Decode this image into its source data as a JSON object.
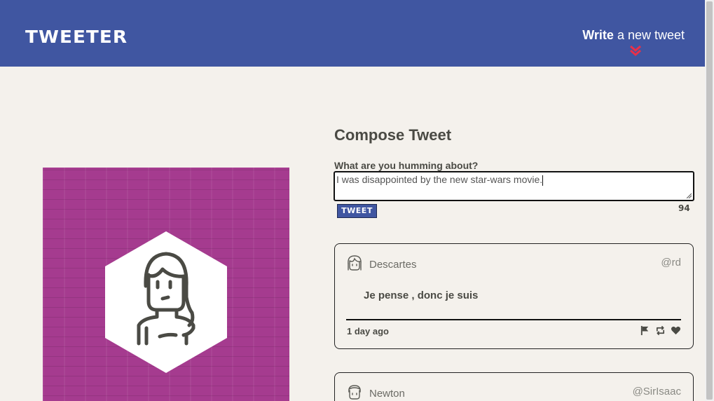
{
  "nav": {
    "brand": "TWEETER",
    "write_bold": "Write",
    "write_rest": " a new tweet",
    "brand_color": "#4056a1",
    "arrow_color": "#e8304a"
  },
  "profile": {
    "background_color": "#a53b8f"
  },
  "compose": {
    "title": "Compose Tweet",
    "label": "What are you humming about?",
    "value": "I was disappointed by the new star-wars movie.",
    "button_label": "TWEET",
    "counter": "94"
  },
  "tweets": [
    {
      "name": "Descartes",
      "handle": "@rd",
      "body": "Je pense , donc je suis",
      "date": "1 day ago",
      "actions": [
        "flag-icon",
        "retweet-icon",
        "heart-icon"
      ]
    },
    {
      "name": "Newton",
      "handle": "@SirIsaac"
    }
  ]
}
